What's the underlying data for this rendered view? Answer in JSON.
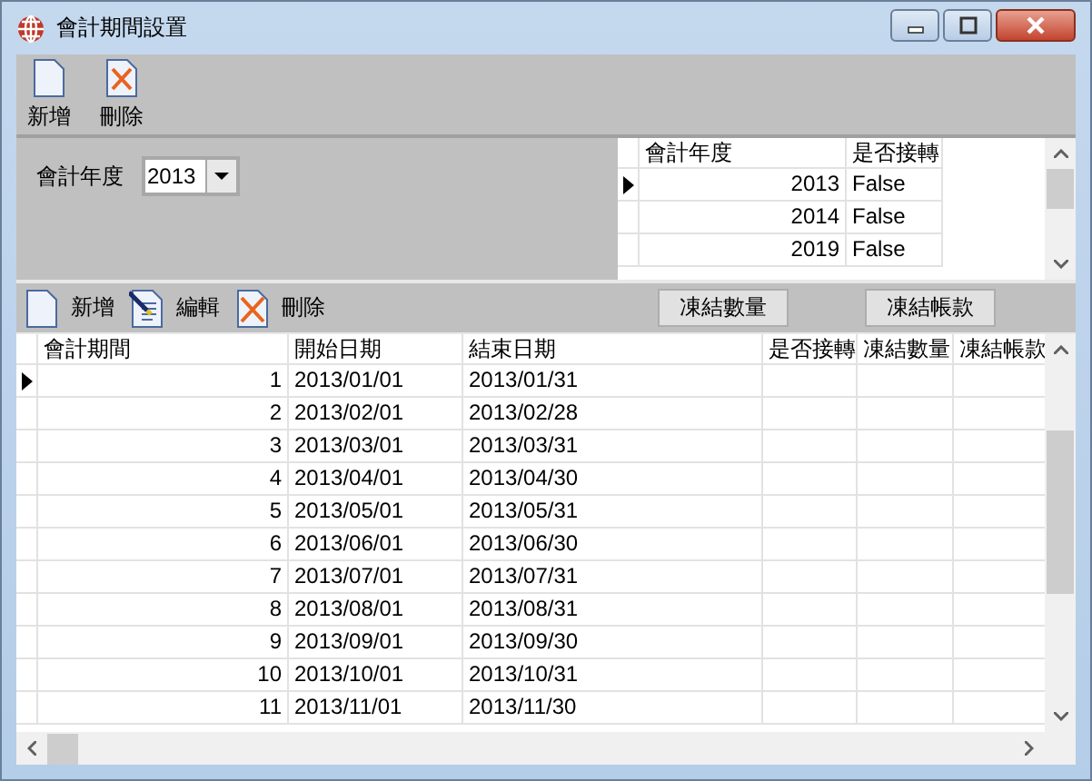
{
  "window": {
    "title": "會計期間設置"
  },
  "toolbar": [
    {
      "label": "新增",
      "kind": "new"
    },
    {
      "label": "刪除",
      "kind": "delete"
    }
  ],
  "year_filter": {
    "label": "會計年度",
    "value": "2013"
  },
  "year_grid": {
    "columns": [
      "會計年度",
      "是否接轉"
    ],
    "rows": [
      {
        "year": "2013",
        "carried": "False",
        "selected": true
      },
      {
        "year": "2014",
        "carried": "False",
        "selected": false
      },
      {
        "year": "2019",
        "carried": "False",
        "selected": false
      }
    ]
  },
  "detail_toolbar": {
    "items": [
      {
        "label": "新增",
        "kind": "new"
      },
      {
        "label": "編輯",
        "kind": "edit"
      },
      {
        "label": "刪除",
        "kind": "delete"
      }
    ],
    "buttons": [
      "凍結數量",
      "凍結帳款"
    ]
  },
  "period_grid": {
    "columns": [
      "會計期間",
      "開始日期",
      "結束日期",
      "是否接轉",
      "凍結數量",
      "凍結帳款"
    ],
    "rows": [
      {
        "period": "1",
        "start": "2013/01/01",
        "end": "2013/01/31",
        "selected": true
      },
      {
        "period": "2",
        "start": "2013/02/01",
        "end": "2013/02/28",
        "selected": false
      },
      {
        "period": "3",
        "start": "2013/03/01",
        "end": "2013/03/31",
        "selected": false
      },
      {
        "period": "4",
        "start": "2013/04/01",
        "end": "2013/04/30",
        "selected": false
      },
      {
        "period": "5",
        "start": "2013/05/01",
        "end": "2013/05/31",
        "selected": false
      },
      {
        "period": "6",
        "start": "2013/06/01",
        "end": "2013/06/30",
        "selected": false
      },
      {
        "period": "7",
        "start": "2013/07/01",
        "end": "2013/07/31",
        "selected": false
      },
      {
        "period": "8",
        "start": "2013/08/01",
        "end": "2013/08/31",
        "selected": false
      },
      {
        "period": "9",
        "start": "2013/09/01",
        "end": "2013/09/30",
        "selected": false
      },
      {
        "period": "10",
        "start": "2013/10/01",
        "end": "2013/10/31",
        "selected": false
      },
      {
        "period": "11",
        "start": "2013/11/01",
        "end": "2013/11/30",
        "selected": false
      }
    ]
  }
}
